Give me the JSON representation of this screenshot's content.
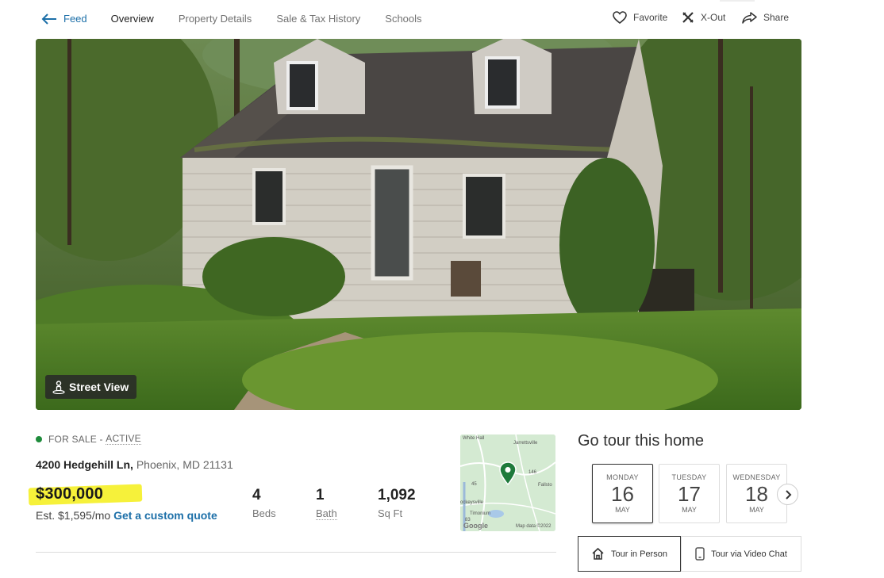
{
  "nav": {
    "back_label": "Feed",
    "tabs": [
      "Overview",
      "Property Details",
      "Sale & Tax History",
      "Schools"
    ],
    "active_tab": "Overview",
    "actions": [
      {
        "label": "Favorite",
        "icon": "heart-icon"
      },
      {
        "label": "X-Out",
        "icon": "x-out-icon"
      },
      {
        "label": "Share",
        "icon": "share-icon"
      }
    ]
  },
  "photo": {
    "street_view_label": "Street View"
  },
  "listing": {
    "status_prefix": "FOR SALE - ",
    "status_active": "ACTIVE",
    "status_color": "#1e8b3b",
    "street": "4200 Hedgehill Ln,",
    "city": "Phoenix, MD 21131",
    "price": "$300,000",
    "est_payment": "Est. $1,595/mo",
    "custom_quote": "Get a custom quote",
    "stats": [
      {
        "value": "4",
        "label": "Beds"
      },
      {
        "value": "1",
        "label": "Bath"
      },
      {
        "value": "1,092",
        "label": "Sq Ft"
      }
    ]
  },
  "map": {
    "labels": [
      "White Hall",
      "Jarrettsville",
      "Fallsto",
      "ockeysville",
      "Timonium",
      "Map data ©2022",
      "Google"
    ],
    "road_labels": [
      "45",
      "146",
      "83"
    ]
  },
  "tour": {
    "title": "Go tour this home",
    "days": [
      {
        "dow": "MONDAY",
        "date": "16",
        "month": "MAY"
      },
      {
        "dow": "TUESDAY",
        "date": "17",
        "month": "MAY"
      },
      {
        "dow": "WEDNESDAY",
        "date": "18",
        "month": "MAY"
      }
    ],
    "in_person": "Tour in Person",
    "video_chat": "Tour via Video Chat"
  },
  "colors": {
    "link": "#1c6fa8",
    "highlight": "#f6f13a",
    "pin": "#1e7a3b"
  }
}
